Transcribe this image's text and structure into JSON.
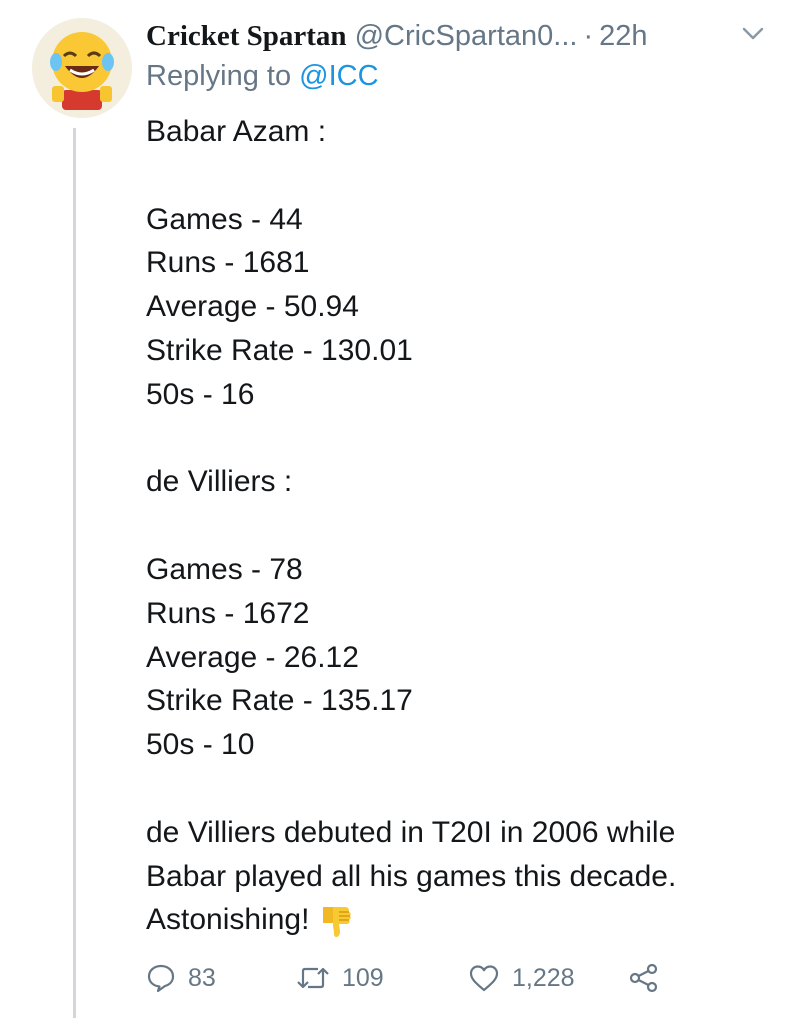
{
  "tweet": {
    "display_name": "Cricket Spartan",
    "handle": "@CricSpartan0...",
    "separator": "·",
    "time": "22h",
    "replying_prefix": "Replying to",
    "replying_to": "@ICC",
    "lines": [
      "Babar Azam :",
      "",
      "Games - 44",
      "Runs - 1681",
      "Average - 50.94",
      "Strike Rate - 130.01",
      "50s - 16",
      "",
      "de Villiers :",
      "",
      "Games - 78",
      "Runs - 1672",
      "Average - 26.12",
      "Strike Rate - 135.17",
      "50s - 10",
      "",
      "de Villiers debuted in T20I in 2006 while",
      "Babar played all his games this decade.",
      "Astonishing!"
    ],
    "end_emoji": "thumbs-down-emoji",
    "avatar_icon": "laughing-crying-emoji-avatar"
  },
  "actions": {
    "reply_count": "83",
    "retweet_count": "109",
    "like_count": "1,228",
    "icons": [
      "reply-icon",
      "retweet-icon",
      "like-icon",
      "share-icon"
    ]
  },
  "colors": {
    "text": "#14171a",
    "secondary": "#657786",
    "link": "#1b95e0",
    "thread_line": "#d2d6da"
  }
}
